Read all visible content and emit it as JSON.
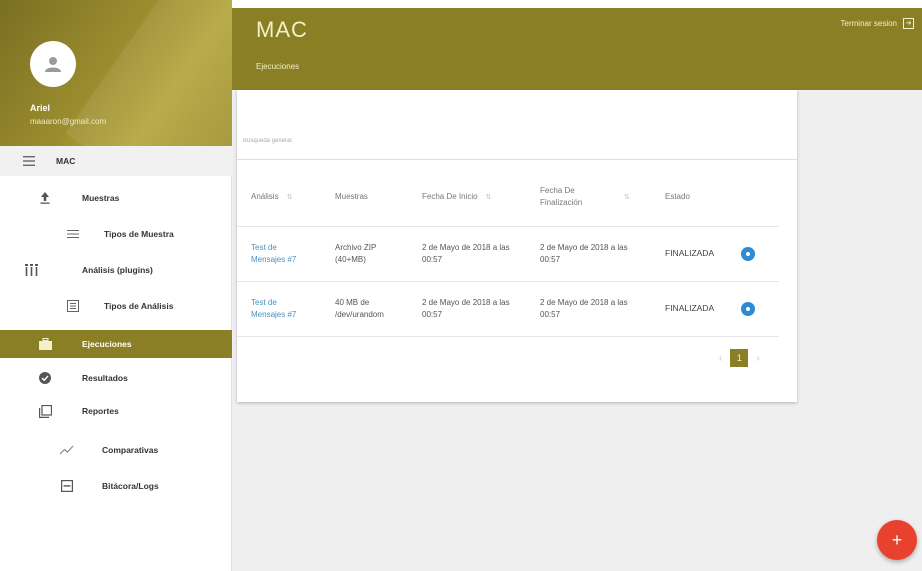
{
  "user": {
    "name": "Ariel",
    "email": "maaaron@gmail.com"
  },
  "sidebar": {
    "section_label": "MAC",
    "items": [
      {
        "label": "Muestras"
      },
      {
        "label": "Tipos de Muestra"
      },
      {
        "label": "Análisis (plugins)"
      },
      {
        "label": "Tipos de Análisis"
      },
      {
        "label": "Ejecuciones"
      },
      {
        "label": "Resultados"
      },
      {
        "label": "Reportes"
      },
      {
        "label": "Comparativas"
      },
      {
        "label": "Bitácora/Logs"
      }
    ]
  },
  "header": {
    "title": "MAC",
    "breadcrumb": "Ejecuciones",
    "logout_label": "Terminar sesion"
  },
  "search": {
    "placeholder": "Búsqueda general"
  },
  "table": {
    "columns": [
      "Análisis",
      "Muestras",
      "Fecha De Inicio",
      "Fecha De Finalización",
      "Estado"
    ],
    "rows": [
      {
        "analysis": "Test de Mensajes #7",
        "sample": "Archivo ZIP (40+MB)",
        "start": "2 de Mayo de 2018 a las 00:57",
        "end": "2 de Mayo de 2018 a las 00:57",
        "status": "FINALIZADA"
      },
      {
        "analysis": "Test de Mensajes #7",
        "sample": "40 MB de /dev/urandom",
        "start": "2 de Mayo de 2018 a las 00:57",
        "end": "2 de Mayo de 2018 a las 00:57",
        "status": "FINALIZADA"
      }
    ]
  },
  "pagination": {
    "current_page": "1"
  },
  "fab": {
    "label": "+"
  },
  "colors": {
    "brand": "#8b7f26",
    "accent": "#2f8ad6",
    "fab": "#e8412d"
  }
}
